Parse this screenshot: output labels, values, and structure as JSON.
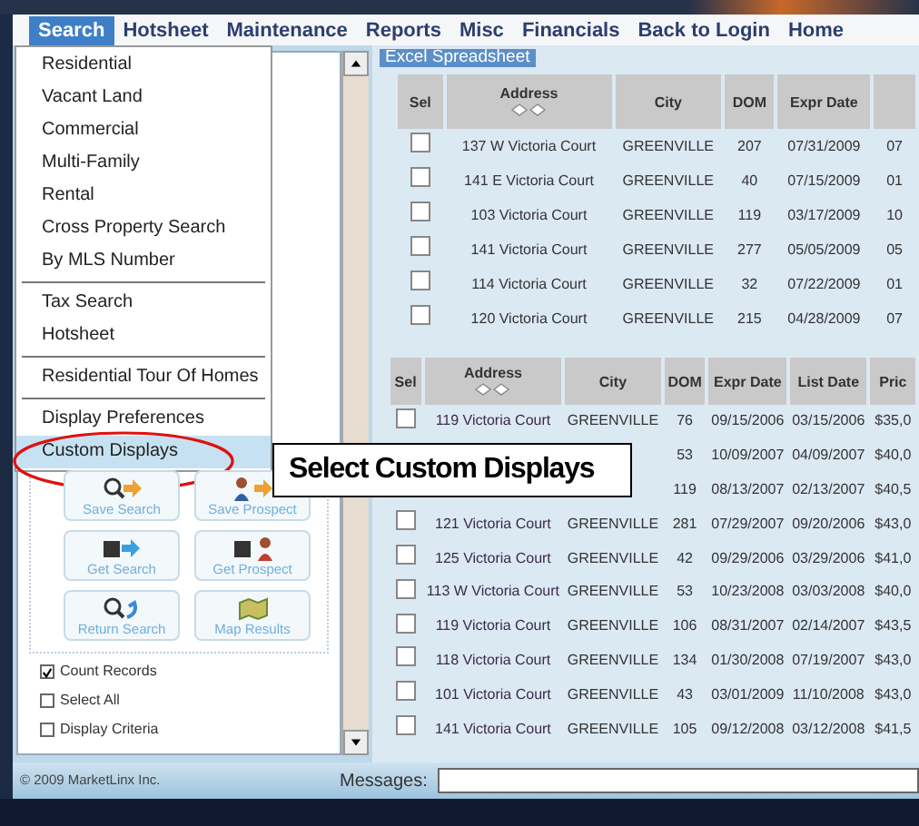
{
  "menu_bar": [
    {
      "label": "Search",
      "selected": true
    },
    {
      "label": "Hotsheet",
      "selected": false
    },
    {
      "label": "Maintenance",
      "selected": false
    },
    {
      "label": "Reports",
      "selected": false
    },
    {
      "label": "Misc",
      "selected": false
    },
    {
      "label": "Financials",
      "selected": false
    },
    {
      "label": "Back to Login",
      "selected": false
    },
    {
      "label": "Home",
      "selected": false
    }
  ],
  "dropdown": {
    "groups": [
      [
        {
          "label": "Residential",
          "selected": false
        },
        {
          "label": "Vacant Land",
          "selected": false
        },
        {
          "label": "Commercial",
          "selected": false
        },
        {
          "label": "Multi-Family",
          "selected": false
        },
        {
          "label": "Rental",
          "selected": false
        },
        {
          "label": "Cross Property Search",
          "selected": false
        },
        {
          "label": "By MLS Number",
          "selected": false
        }
      ],
      [
        {
          "label": "Tax Search",
          "selected": false
        },
        {
          "label": "Hotsheet",
          "selected": false
        }
      ],
      [
        {
          "label": "Residential Tour Of Homes",
          "selected": false
        }
      ],
      [
        {
          "label": "Display Preferences",
          "selected": false
        },
        {
          "label": "Custom Displays",
          "selected": true
        }
      ]
    ]
  },
  "left_panel": {
    "tool_buttons": [
      {
        "label": "Save Search"
      },
      {
        "label": "Save Prospect"
      },
      {
        "label": "Get Search"
      },
      {
        "label": "Get Prospect"
      },
      {
        "label": "Return Search"
      },
      {
        "label": "Map Results"
      }
    ],
    "options": [
      {
        "label": "Count Records",
        "checked": true
      },
      {
        "label": "Select All",
        "checked": false
      },
      {
        "label": "Display Criteria",
        "checked": false
      }
    ]
  },
  "spreadsheet": {
    "title": "Excel Spreadsheet",
    "table_1": {
      "columns": [
        "Sel",
        "Address",
        "City",
        "DOM",
        "Expr Date"
      ],
      "rows": [
        {
          "checked": false,
          "address": "137 W Victoria Court",
          "city": "GREENVILLE",
          "dom": "207",
          "expr_date": "07/31/2009",
          "column_6": "07"
        },
        {
          "checked": false,
          "address": "141 E Victoria Court",
          "city": "GREENVILLE",
          "dom": "40",
          "expr_date": "07/15/2009",
          "column_6": "01"
        },
        {
          "checked": false,
          "address": "103 Victoria Court",
          "city": "GREENVILLE",
          "dom": "119",
          "expr_date": "03/17/2009",
          "column_6": "10"
        },
        {
          "checked": false,
          "address": "141 Victoria Court",
          "city": "GREENVILLE",
          "dom": "277",
          "expr_date": "05/05/2009",
          "column_6": "05"
        },
        {
          "checked": false,
          "address": "114 Victoria Court",
          "city": "GREENVILLE",
          "dom": "32",
          "expr_date": "07/22/2009",
          "column_6": "01"
        },
        {
          "checked": false,
          "address": "120 Victoria Court",
          "city": "GREENVILLE",
          "dom": "215",
          "expr_date": "04/28/2009",
          "column_6": "07"
        }
      ]
    },
    "table_2": {
      "columns": [
        "Sel",
        "Address",
        "City",
        "DOM",
        "Expr Date",
        "List Date",
        "Pric"
      ],
      "rows": [
        {
          "checked": false,
          "address": "119 Victoria Court",
          "city": "GREENVILLE",
          "dom": "76",
          "expr_date": "09/15/2006",
          "list_date": "03/15/2006",
          "price": "$35,0"
        },
        {
          "dom": "53",
          "expr_date": "10/09/2007",
          "list_date": "04/09/2007",
          "price": "$40,0"
        },
        {
          "dom": "119",
          "expr_date": "08/13/2007",
          "list_date": "02/13/2007",
          "price": "$40,5"
        },
        {
          "checked": false,
          "address": "121 Victoria Court",
          "city": "GREENVILLE",
          "dom": "281",
          "expr_date": "07/29/2007",
          "list_date": "09/20/2006",
          "price": "$43,0"
        },
        {
          "checked": false,
          "address": "125 Victoria Court",
          "city": "GREENVILLE",
          "dom": "42",
          "expr_date": "09/29/2006",
          "list_date": "03/29/2006",
          "price": "$41,0"
        },
        {
          "checked": false,
          "address": "113 W Victoria Court",
          "city": "GREENVILLE",
          "dom": "53",
          "expr_date": "10/23/2008",
          "list_date": "03/03/2008",
          "price": "$40,0"
        },
        {
          "checked": false,
          "address": "119 Victoria Court",
          "city": "GREENVILLE",
          "dom": "106",
          "expr_date": "08/31/2007",
          "list_date": "02/14/2007",
          "price": "$43,5"
        },
        {
          "checked": false,
          "address": "118 Victoria Court",
          "city": "GREENVILLE",
          "dom": "134",
          "expr_date": "01/30/2008",
          "list_date": "07/19/2007",
          "price": "$43,0"
        },
        {
          "checked": false,
          "address": "101 Victoria Court",
          "city": "GREENVILLE",
          "dom": "43",
          "expr_date": "03/01/2009",
          "list_date": "11/10/2008",
          "price": "$43,0"
        },
        {
          "checked": false,
          "address": "141 Victoria Court",
          "city": "GREENVILLE",
          "dom": "105",
          "expr_date": "09/12/2008",
          "list_date": "03/12/2008",
          "price": "$41,5"
        }
      ]
    }
  },
  "callout": {
    "text": "Select Custom Displays"
  },
  "footer": {
    "copyright": "© 2009 MarketLinx Inc.",
    "messages_label": "Messages:"
  }
}
